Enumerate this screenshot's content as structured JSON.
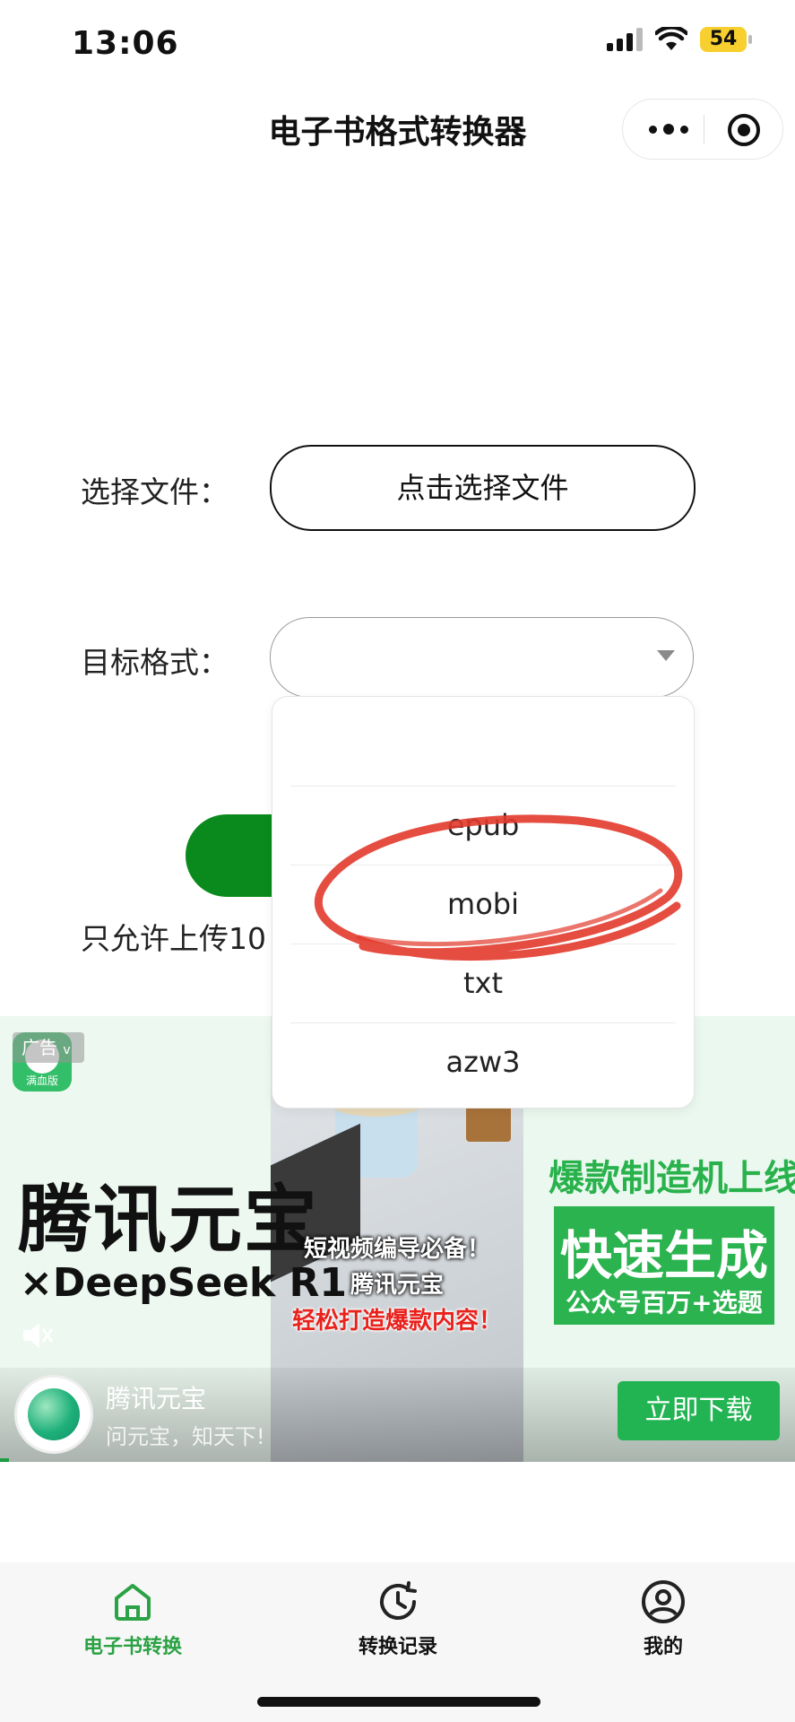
{
  "status_bar": {
    "time": "13:06",
    "battery": "54"
  },
  "nav": {
    "title": "电子书格式转换器"
  },
  "form": {
    "file_label": "选择文件：",
    "file_button": "点击选择文件",
    "format_label": "目标格式：",
    "selected_format": "",
    "note": "只允许上传10"
  },
  "dropdown": {
    "options": [
      "epub",
      "mobi",
      "txt",
      "azw3"
    ],
    "highlighted": "mobi"
  },
  "ad": {
    "tag": "广告",
    "tag_chevron": "v",
    "icon_badge": "满血版",
    "brand": "腾讯元宝",
    "brand_sub": "×DeepSeek R1",
    "photo_line1": "短视频编导必备！",
    "photo_line2": "腾讯元宝",
    "photo_line3": "轻松打造爆款内容！",
    "headline": "爆款制造机上线",
    "box_big": "快速生成",
    "box_small": "公众号百万+选题",
    "app_name": "腾讯元宝",
    "slogan": "问元宝，知天下!",
    "download": "立即下载",
    "accent": "#2bb34f"
  },
  "tabbar": {
    "active_color": "#2ba245",
    "tabs": [
      {
        "label": "电子书转换",
        "icon": "home-icon",
        "active": true
      },
      {
        "label": "转换记录",
        "icon": "history-icon",
        "active": false
      },
      {
        "label": "我的",
        "icon": "user-icon",
        "active": false
      }
    ]
  }
}
